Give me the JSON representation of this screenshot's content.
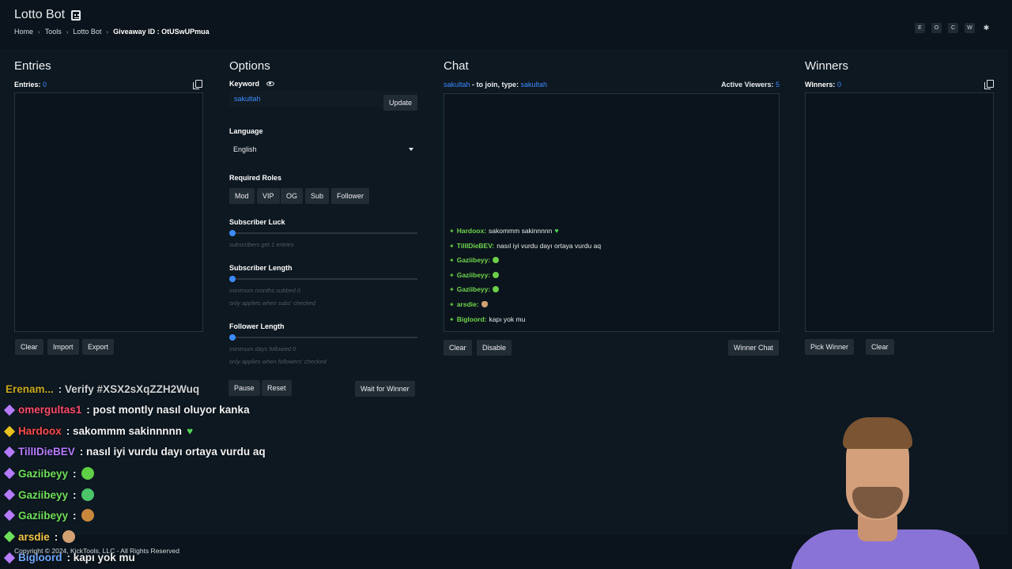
{
  "app": {
    "title": "Lotto Bot"
  },
  "breadcrumb": {
    "home": "Home",
    "tools": "Tools",
    "lotto": "Lotto Bot",
    "giveaway": "Giveaway ID :  OtUSwUPmua"
  },
  "corner_buttons": [
    "E",
    "O",
    "C",
    "W",
    "✱"
  ],
  "entries": {
    "title": "Entries",
    "label": "Entries:",
    "count": "0",
    "buttons": {
      "clear": "Clear",
      "import": "Import",
      "export": "Export"
    }
  },
  "options": {
    "title": "Options",
    "keyword_label": "Keyword",
    "keyword_value": "sakultah",
    "update": "Update",
    "language_label": "Language",
    "language_value": "English",
    "roles_label": "Required Roles",
    "roles": [
      "Mod",
      "VIP",
      "OG",
      "Sub",
      "Follower"
    ],
    "sub_luck_label": "Subscriber Luck",
    "sub_luck_hint": "subscribers get 1 entries",
    "sub_luck_level": 0,
    "sub_length_label": "Subscriber Length",
    "sub_length_hint": "minimum months subbed 0",
    "sub_length_hint2": "only applies when subs' checked",
    "sub_length_level": 0,
    "follower_length_label": "Follower Length",
    "follower_length_hint": "minimum days followed 0",
    "follower_length_hint2": "only applies when followers' checked",
    "follower_length_level": 0,
    "pause": "Pause",
    "reset": "Reset",
    "wait": "Wait for Winner"
  },
  "chat": {
    "title": "Chat",
    "join_user": "sakultah",
    "join_text": " - to join, type: ",
    "join_keyword": "sakultah",
    "viewers_label": "Active Viewers:",
    "viewers": "5",
    "messages": [
      {
        "user": "Hardoox:",
        "text": "sakommm sakinnnnn",
        "extra": "heart"
      },
      {
        "user": "TillIDieBEV:",
        "text": "nasıl iyi vurdu dayı ortaya vurdu aq",
        "extra": ""
      },
      {
        "user": "Gaziibeyy:",
        "text": "",
        "extra": "emote"
      },
      {
        "user": "Gaziibeyy:",
        "text": "",
        "extra": "emote"
      },
      {
        "user": "Gaziibeyy:",
        "text": "",
        "extra": "emote"
      },
      {
        "user": "arsdie:",
        "text": "",
        "extra": "peach"
      },
      {
        "user": "Bigloord:",
        "text": "kapı yok mu",
        "extra": ""
      }
    ],
    "buttons": {
      "clear": "Clear",
      "disable": "Disable",
      "winner_chat": "Winner Chat"
    }
  },
  "winners": {
    "title": "Winners",
    "label": "Winners:",
    "count": "0",
    "buttons": {
      "pick": "Pick Winner",
      "clear": "Clear"
    }
  },
  "overlay_chat": [
    {
      "user": "Erenam...",
      "text": ": Verify #XSX2sXqZZH2Wuq",
      "user_color": "#e8c21f",
      "gem_color": "#e8c21f"
    },
    {
      "user": "omergultas1",
      "text": ": post montly nasıl oluyor kanka",
      "user_color": "#ff4a6b",
      "gem_color": "#b67bff"
    },
    {
      "user": "Hardoox",
      "text": ": sakommm sakinnnnn",
      "user_color": "#ff4a4a",
      "gem_color": "#e8c21f"
    },
    {
      "user": "TillIDieBEV",
      "text": ": nasıl iyi vurdu dayı ortaya vurdu aq",
      "user_color": "#b67bff",
      "gem_color": "#b67bff"
    },
    {
      "user": "Gaziibeyy",
      "text": ":",
      "user_color": "#6fe05a",
      "gem_color": "#b67bff"
    },
    {
      "user": "Gaziibeyy",
      "text": ":",
      "user_color": "#6fe05a",
      "gem_color": "#b67bff"
    },
    {
      "user": "Gaziibeyy",
      "text": ":",
      "user_color": "#6fe05a",
      "gem_color": "#b67bff"
    },
    {
      "user": "arsdie",
      "text": ":",
      "user_color": "#f2c84b",
      "gem_color": "#6fe05a"
    },
    {
      "user": "Bigloord",
      "text": ": kapı yok mu",
      "user_color": "#6fa8ff",
      "gem_color": "#b67bff"
    }
  ],
  "footer": {
    "copyright": "Copyright © 2024, KickTools, LLC - All Rights Reserved"
  },
  "colors": {
    "accent": "#3d8bff",
    "background": "#0b141c",
    "chat_user": "#6fd44d"
  }
}
